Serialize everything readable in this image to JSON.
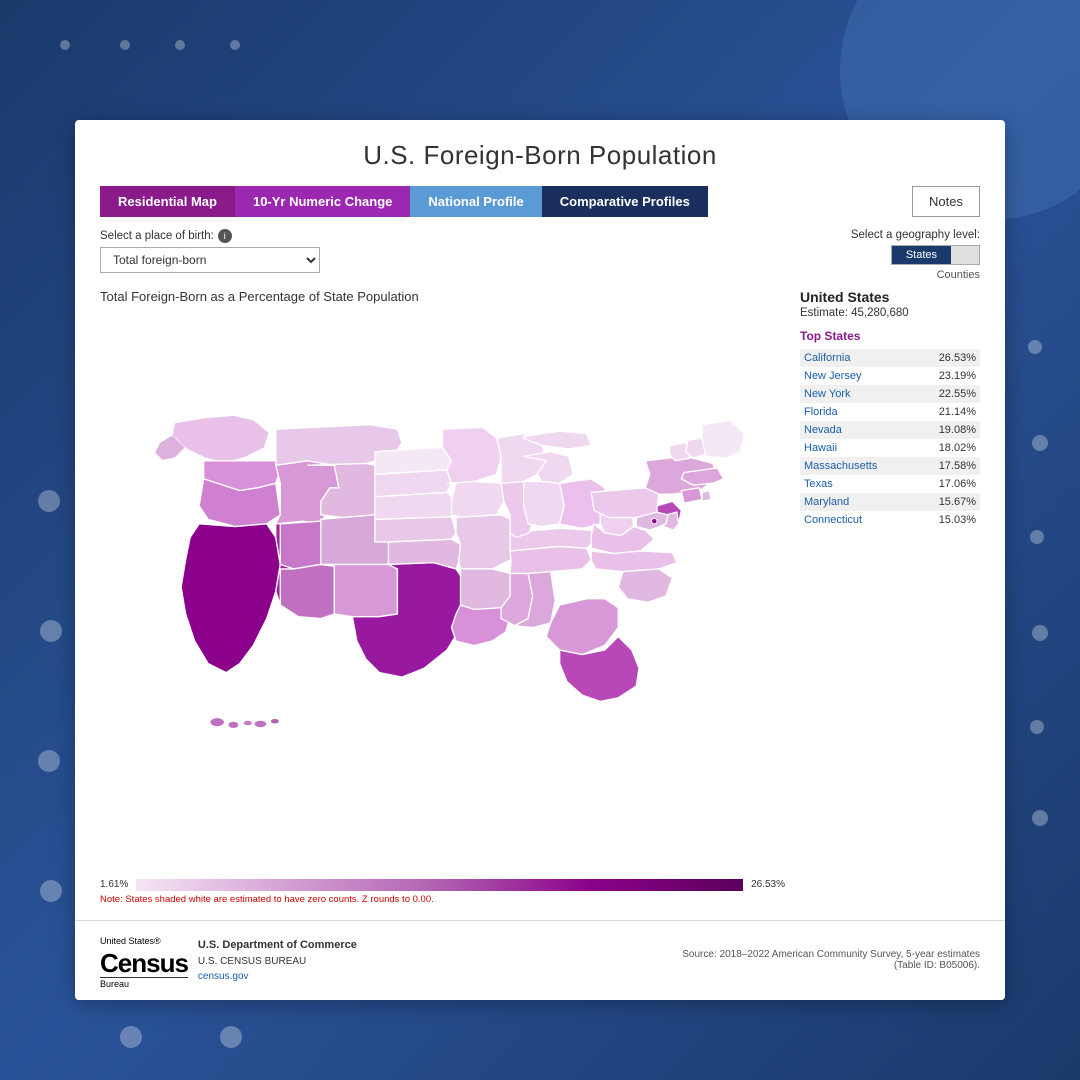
{
  "page": {
    "title": "U.S. Foreign-Born Population",
    "background_color": "#1a3a6b"
  },
  "tabs": [
    {
      "label": "Residential Map",
      "key": "residential",
      "active": false
    },
    {
      "label": "10-Yr Numeric Change",
      "key": "10yr",
      "active": false
    },
    {
      "label": "National Profile",
      "key": "national",
      "active": false
    },
    {
      "label": "Comparative Profiles",
      "key": "comparative",
      "active": true
    }
  ],
  "notes_button": "Notes",
  "controls": {
    "place_label": "Select a place of birth:",
    "place_value": "Total foreign-born",
    "geo_label": "Select a geography level:",
    "geo_states": "States",
    "geo_counties": "Counties"
  },
  "map": {
    "title": "Total Foreign-Born as a Percentage of State Population",
    "legend_min": "1.61%",
    "legend_max": "26.53%",
    "legend_note": "Note: States shaded white are estimated to have zero counts. Z rounds to 0.00."
  },
  "sidebar": {
    "region": "United States",
    "estimate_label": "Estimate: 45,280,680",
    "top_states_label": "Top States",
    "states": [
      {
        "name": "California",
        "pct": "26.53%",
        "highlight": true
      },
      {
        "name": "New Jersey",
        "pct": "23.19%",
        "highlight": false
      },
      {
        "name": "New York",
        "pct": "22.55%",
        "highlight": false
      },
      {
        "name": "Florida",
        "pct": "21.14%",
        "highlight": true
      },
      {
        "name": "Nevada",
        "pct": "19.08%",
        "highlight": false
      },
      {
        "name": "Hawaii",
        "pct": "18.02%",
        "highlight": true
      },
      {
        "name": "Massachusetts",
        "pct": "17.58%",
        "highlight": false
      },
      {
        "name": "Texas",
        "pct": "17.06%",
        "highlight": true
      },
      {
        "name": "Maryland",
        "pct": "15.67%",
        "highlight": false
      },
      {
        "name": "Connecticut",
        "pct": "15.03%",
        "highlight": true
      }
    ]
  },
  "footer": {
    "united_states": "United States®",
    "census": "Census",
    "bureau": "Bureau",
    "dept_name": "U.S. Department of Commerce",
    "census_bureau": "U.S. CENSUS BUREAU",
    "url": "census.gov",
    "source": "Source: 2018–2022 American Community Survey, 5-year estimates (Table ID: B05006)."
  }
}
